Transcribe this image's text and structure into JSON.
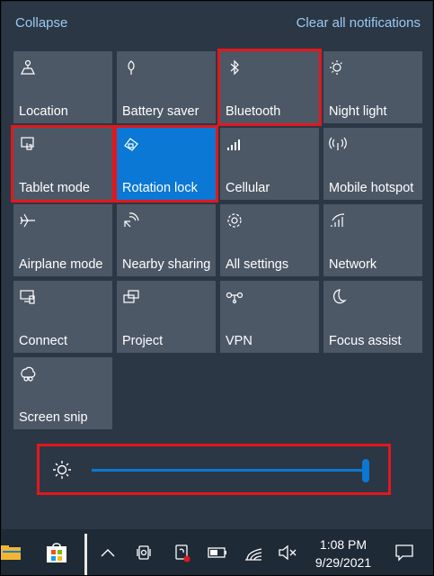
{
  "header": {
    "collapse_label": "Collapse",
    "clear_all_label": "Clear all notifications"
  },
  "tiles": [
    {
      "label": "Location",
      "icon": "location-icon",
      "active": false
    },
    {
      "label": "Battery saver",
      "icon": "battery-saver-icon",
      "active": false
    },
    {
      "label": "Bluetooth",
      "icon": "bluetooth-icon",
      "active": false
    },
    {
      "label": "Night light",
      "icon": "night-light-icon",
      "active": false
    },
    {
      "label": "Tablet mode",
      "icon": "tablet-mode-icon",
      "active": false
    },
    {
      "label": "Rotation lock",
      "icon": "rotation-lock-icon",
      "active": true
    },
    {
      "label": "Cellular",
      "icon": "cellular-icon",
      "active": false
    },
    {
      "label": "Mobile hotspot",
      "icon": "mobile-hotspot-icon",
      "active": false
    },
    {
      "label": "Airplane mode",
      "icon": "airplane-icon",
      "active": false
    },
    {
      "label": "Nearby sharing",
      "icon": "nearby-sharing-icon",
      "active": false
    },
    {
      "label": "All settings",
      "icon": "gear-icon",
      "active": false
    },
    {
      "label": "Network",
      "icon": "network-icon",
      "active": false
    },
    {
      "label": "Connect",
      "icon": "connect-icon",
      "active": false
    },
    {
      "label": "Project",
      "icon": "project-icon",
      "active": false
    },
    {
      "label": "VPN",
      "icon": "vpn-icon",
      "active": false
    },
    {
      "label": "Focus assist",
      "icon": "moon-icon",
      "active": false
    },
    {
      "label": "Screen snip",
      "icon": "screen-snip-icon",
      "active": false
    }
  ],
  "brightness": {
    "icon": "brightness-sun-icon",
    "level_percent": 100
  },
  "taskbar": {
    "time": "1:08 PM",
    "date": "9/29/2021",
    "icons": [
      "file-explorer-icon",
      "store-icon",
      "chevron-up-icon",
      "camera-icon",
      "rotation-icon",
      "battery-icon",
      "wifi-icon",
      "speaker-muted-icon",
      "notification-icon"
    ]
  },
  "colors": {
    "accent": "#0a78d4",
    "highlight": "#e3171d",
    "tile": "#4d5866",
    "link": "#9cc9f5"
  }
}
